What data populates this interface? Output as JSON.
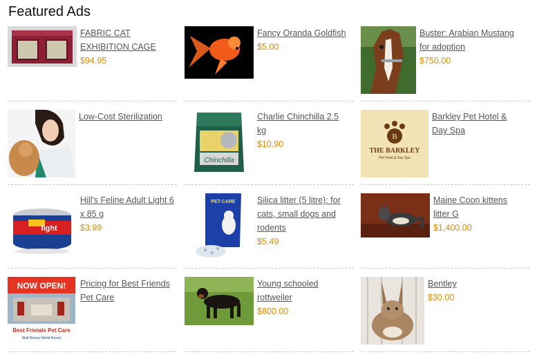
{
  "section": {
    "title": "Featured Ads"
  },
  "ads": [
    {
      "title": "FABRIC CAT EXHIBITION CAGE",
      "price": "$94.95",
      "icon": "cat-cage-image"
    },
    {
      "title": "Fancy Oranda Goldfish",
      "price": "$5.00",
      "icon": "goldfish-image"
    },
    {
      "title": "Buster: Arabian Mustang for adoption",
      "price": "$750.00",
      "icon": "horse-image"
    },
    {
      "title": "Low-Cost Sterilization",
      "price": "",
      "icon": "vet-with-dog-image"
    },
    {
      "title": "Charlie Chinchilla 2.5 kg",
      "price": "$10.90",
      "icon": "chinchilla-food-bag-image"
    },
    {
      "title": "Barkley Pet Hotel & Day Spa",
      "price": "",
      "icon": "barkley-logo-image"
    },
    {
      "title": "Hill's Feline Adult Light 6 x 85 g",
      "price": "$3.99",
      "icon": "cat-food-can-image"
    },
    {
      "title": "Silica litter (5 litre): for cats, small dogs and rodents",
      "price": "$5.49",
      "icon": "litter-bag-image"
    },
    {
      "title": "Maine Coon kittens litter G",
      "price": "$1,400.00",
      "icon": "maine-coon-image"
    },
    {
      "title": "Pricing for Best Friends Pet Care",
      "price": "",
      "icon": "best-friends-sign-image"
    },
    {
      "title": "Young schooled rottweiler",
      "price": "$800.00",
      "icon": "rottweiler-image"
    },
    {
      "title": "Bentley",
      "price": "$30.00",
      "icon": "rabbit-image"
    }
  ],
  "image_text": {
    "barkley_name": "THE BARKLEY",
    "barkley_sub": "Pet Hotel & Day Spa",
    "now_open": "NOW OPEN!",
    "best_friends": "Best Friends Pet Care",
    "resort": "Walt Disney World Resort",
    "chinchilla_brand": "Chinchilla",
    "cat_food_brand": "light",
    "litter_brand": "PET-CARE"
  },
  "colors": {
    "price": "#e08a00",
    "link": "#555555",
    "separator": "#c8c8c8"
  }
}
